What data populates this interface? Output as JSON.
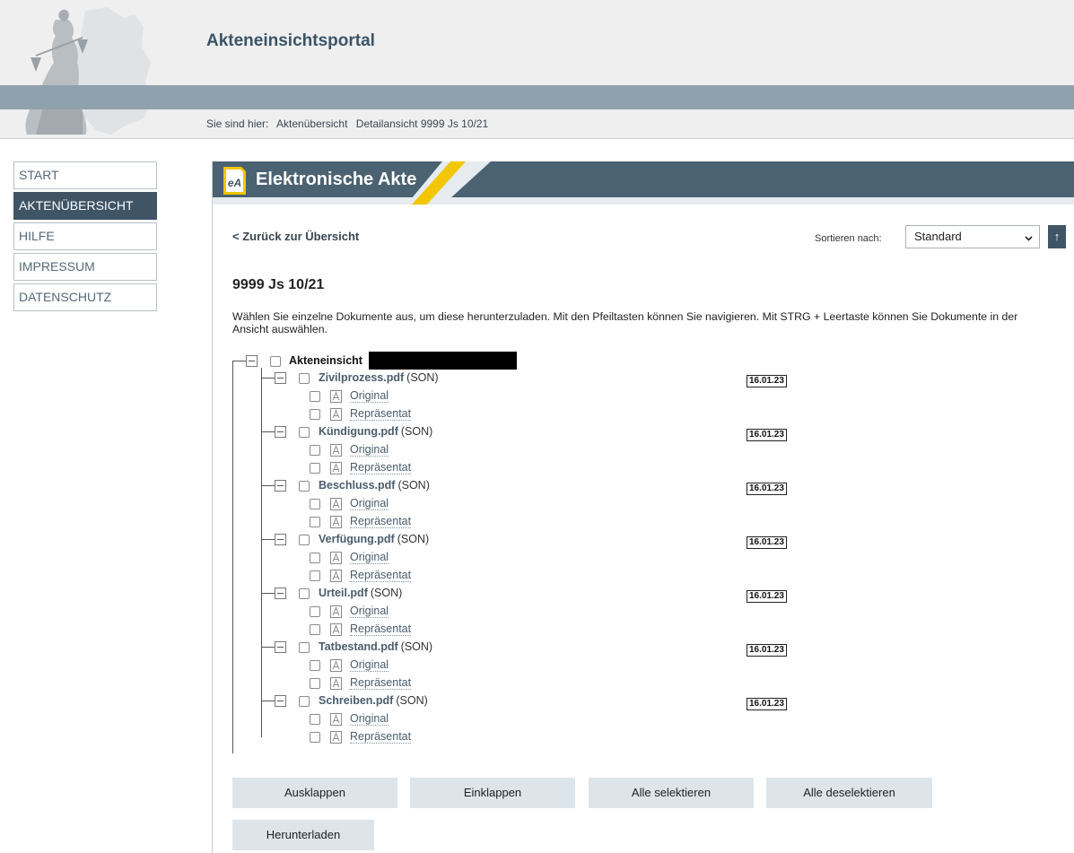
{
  "header": {
    "app_title": "Akteneinsichtsportal",
    "breadcrumb": {
      "prefix": "Sie sind hier:",
      "items": [
        "Aktenübersicht",
        "Detailansicht 9999 Js 10/21"
      ]
    }
  },
  "sidebar": {
    "items": [
      {
        "label": "START",
        "active": false
      },
      {
        "label": "AKTENÜBERSICHT",
        "active": true
      },
      {
        "label": "HILFE",
        "active": false
      },
      {
        "label": "IMPRESSUM",
        "active": false
      },
      {
        "label": "DATENSCHUTZ",
        "active": false
      }
    ]
  },
  "banner": {
    "icon_text": "eA",
    "title": "Elektronische Akte"
  },
  "main": {
    "back_link": "< Zurück zur Übersicht",
    "sort": {
      "label": "Sortieren nach:",
      "selected": "Standard",
      "direction_symbol": "↑"
    },
    "case_title": "9999 Js 10/21",
    "instructions": "Wählen Sie einzelne Dokumente aus, um diese herunterzuladen. Mit den Pfeiltasten können Sie navigieren. Mit STRG + Leertaste können Sie Dokumente in der Ansicht auswählen.",
    "tree": {
      "root_label": "Akteneinsicht",
      "documents": [
        {
          "name": "Zivilprozess.pdf",
          "type": "(SON)",
          "date": "16.01.23"
        },
        {
          "name": "Kündigung.pdf",
          "type": "(SON)",
          "date": "16.01.23"
        },
        {
          "name": "Beschluss.pdf",
          "type": "(SON)",
          "date": "16.01.23"
        },
        {
          "name": "Verfügung.pdf",
          "type": "(SON)",
          "date": "16.01.23"
        },
        {
          "name": "Urteil.pdf",
          "type": "(SON)",
          "date": "16.01.23"
        },
        {
          "name": "Tatbestand.pdf",
          "type": "(SON)",
          "date": "16.01.23"
        },
        {
          "name": "Schreiben.pdf",
          "type": "(SON)",
          "date": "16.01.23"
        }
      ],
      "variants": [
        "Original",
        "Repräsentat"
      ]
    },
    "buttons": {
      "expand": "Ausklappen",
      "collapse": "Einklappen",
      "select_all": "Alle selektieren",
      "deselect_all": "Alle deselektieren",
      "download": "Herunterladen"
    }
  },
  "colors": {
    "brand_dark": "#4a6272",
    "accent_yellow": "#f2c600",
    "header_band": "#8fa1ad",
    "link": "#495d6c"
  }
}
